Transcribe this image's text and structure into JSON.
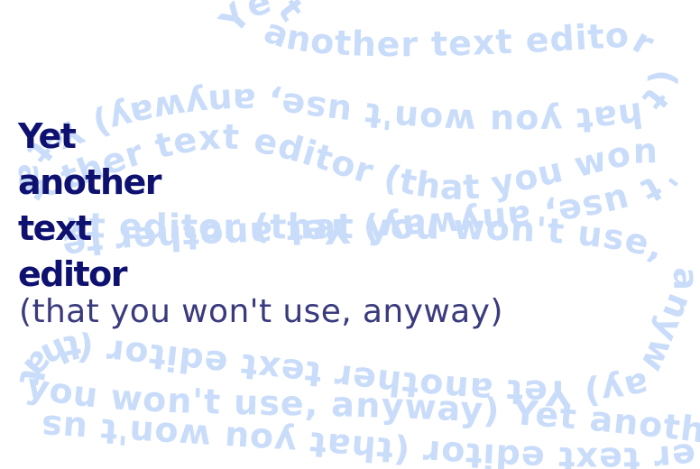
{
  "colors": {
    "background": "#ffffff",
    "headline": "#0e1170",
    "tagline": "#3a3a7e",
    "backdrop_text": "#c9dcfa"
  },
  "headline": {
    "words": [
      "Yet",
      "another",
      "text",
      "editor"
    ]
  },
  "tagline": {
    "text": "(that you won't use, anyway)"
  },
  "backdrop": {
    "text": "Yet another text editor (that you won't use, anyway)"
  }
}
